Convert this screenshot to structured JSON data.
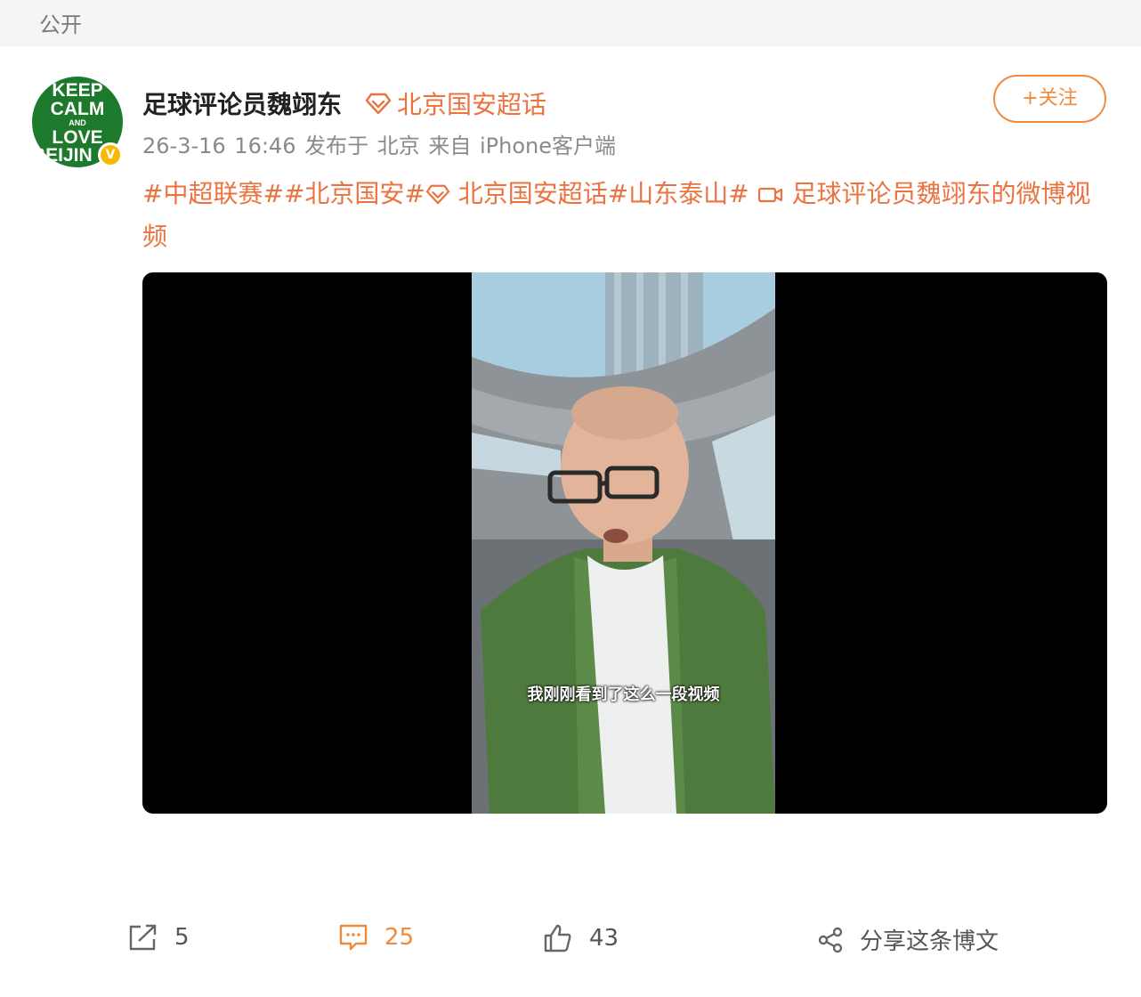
{
  "visibility": "公开",
  "user": {
    "name": "足球评论员魏翊东",
    "avatar_lines": [
      "KEEP",
      "CALM",
      "AND",
      "LOVE",
      "BEIJIN"
    ],
    "verified_badge": "V"
  },
  "supertopic": {
    "label": "北京国安超话",
    "icon": "diamond-icon"
  },
  "follow_button": "+关注",
  "meta": {
    "time": "26-3-16 16:46",
    "posted_in": "发布于 北京",
    "source": "来自 iPhone客户端"
  },
  "post": {
    "tags": [
      "#中超联赛#",
      "#北京国安#",
      "北京国安超话",
      "#山东泰山#"
    ],
    "video_link": "足球评论员魏翊东的微博视频"
  },
  "video": {
    "subtitle": "我刚刚看到了这么一段视频"
  },
  "actions": {
    "repost_count": "5",
    "comment_count": "25",
    "like_count": "43",
    "share_label": "分享这条博文"
  },
  "colors": {
    "accent": "#eb7340",
    "follow": "#f08a3d",
    "avatar_bg": "#1d7a2c"
  }
}
